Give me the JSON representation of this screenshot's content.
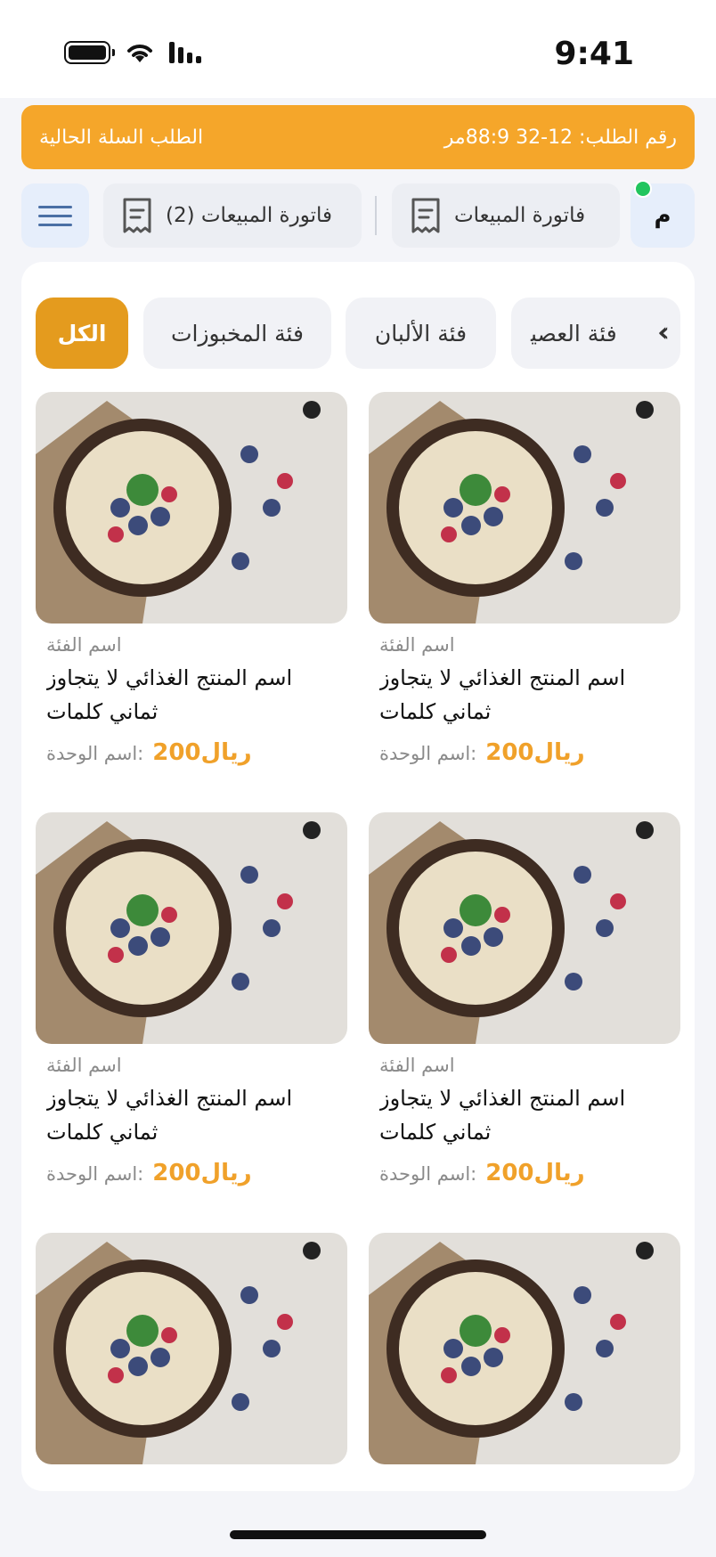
{
  "status_bar": {
    "time": "9:41"
  },
  "order_banner": {
    "left_text": "ﺍﻟﻄﻠﺐ ﺍﻟﺴﻠﺔ ﺍﻟﺤﺎﻟﻴﺔ",
    "right_text": "ﺭﻗﻢ ﺍﻟﻄﻠﺐ: 12-32 88:9ﻣﺮ"
  },
  "header": {
    "pill_1_label": "ﻓﺎﺗﻮﺭﺓ ﺍﻟﻤﺒﻴﻌﺎﺕ (2)",
    "pill_2_label": "ﻓﺎﺗﻮﺭﺓ ﺍﻟﻤﺒﻴﻌﺎﺕ",
    "user_initial": "ﻡ",
    "receipt_icon": "receipt-icon",
    "menu_icon": "hamburger-icon"
  },
  "categories": [
    {
      "label": "ﺍﻟﻜﻞ",
      "active": true
    },
    {
      "label": "ﻓﺌﺔ ﺍﻟﻤﺨﺒﻮﺯﺍﺕ"
    },
    {
      "label": "ﻓﺌﺔ ﺍﻷﻟﺒﺎﻥ"
    },
    {
      "label": "ﻓﺌﺔ ﺍﻟﻌﺼﻴ"
    }
  ],
  "products": [
    {
      "subtitle": "ﺍﺳﻢ ﺍﻟﻔﺌﺔ",
      "title": "ﺍﺳﻢ ﺍﻟﻤﻨﺘﺞ ﺍﻟﻐﺬﺍﺋﻲ ﻻ ﻳﺘﺠﺎﻭﺯ ﺛﻤﺎﻧﻲ ﻛﻠﻤﺎﺕ",
      "price": "200ﺭﻳﺎﻝ",
      "unit": "ﺍﺳﻢ ﺍﻟﻮﺣﺪﺓ:"
    },
    {
      "subtitle": "ﺍﺳﻢ ﺍﻟﻔﺌﺔ",
      "title": "ﺍﺳﻢ ﺍﻟﻤﻨﺘﺞ ﺍﻟﻐﺬﺍﺋﻲ ﻻ ﻳﺘﺠﺎﻭﺯ ﺛﻤﺎﻧﻲ ﻛﻠﻤﺎﺕ",
      "price": "200ﺭﻳﺎﻝ",
      "unit": "ﺍﺳﻢ ﺍﻟﻮﺣﺪﺓ:"
    },
    {
      "subtitle": "ﺍﺳﻢ ﺍﻟﻔﺌﺔ",
      "title": "ﺍﺳﻢ ﺍﻟﻤﻨﺘﺞ ﺍﻟﻐﺬﺍﺋﻲ ﻻ ﻳﺘﺠﺎﻭﺯ ﺛﻤﺎﻧﻲ ﻛﻠﻤﺎﺕ",
      "price": "200ﺭﻳﺎﻝ",
      "unit": "ﺍﺳﻢ ﺍﻟﻮﺣﺪﺓ:"
    },
    {
      "subtitle": "ﺍﺳﻢ ﺍﻟﻔﺌﺔ",
      "title": "ﺍﺳﻢ ﺍﻟﻤﻨﺘﺞ ﺍﻟﻐﺬﺍﺋﻲ ﻻ ﻳﺘﺠﺎﻭﺯ ﺛﻤﺎﻧﻲ ﻛﻠﻤﺎﺕ",
      "price": "200ﺭﻳﺎﻝ",
      "unit": "ﺍﺳﻢ ﺍﻟﻮﺣﺪﺓ:"
    },
    {
      "subtitle": "",
      "title": "",
      "price": "",
      "unit": ""
    },
    {
      "subtitle": "",
      "title": "",
      "price": "",
      "unit": ""
    }
  ],
  "colors": {
    "accent": "#f5a62a",
    "accent_dark": "#e49b1e",
    "price": "#f0a12a",
    "online": "#22c55e"
  }
}
